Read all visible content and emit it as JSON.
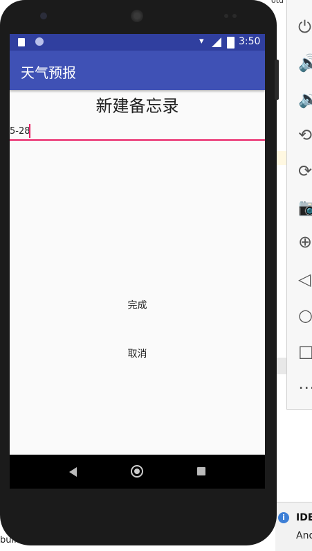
{
  "ide": {
    "top_fragment": "otu",
    "bottom_text": "build fi",
    "notification": {
      "title": "IDE",
      "subtitle": "And"
    }
  },
  "emulator_toolbar": {
    "items": [
      "power-icon",
      "volume-up-icon",
      "volume-down-icon",
      "rotate-left-icon",
      "rotate-right-icon",
      "camera-icon",
      "zoom-icon",
      "back-icon",
      "home-icon",
      "overview-icon",
      "more-icon"
    ]
  },
  "status_bar": {
    "time": "3:50",
    "color": "#303f9f"
  },
  "app_bar": {
    "title": "天气预报",
    "color": "#3f51b5"
  },
  "memo": {
    "page_title": "新建备忘录",
    "input_value": "5-28",
    "accent_color": "#e91e63",
    "done_label": "完成",
    "cancel_label": "取消"
  }
}
